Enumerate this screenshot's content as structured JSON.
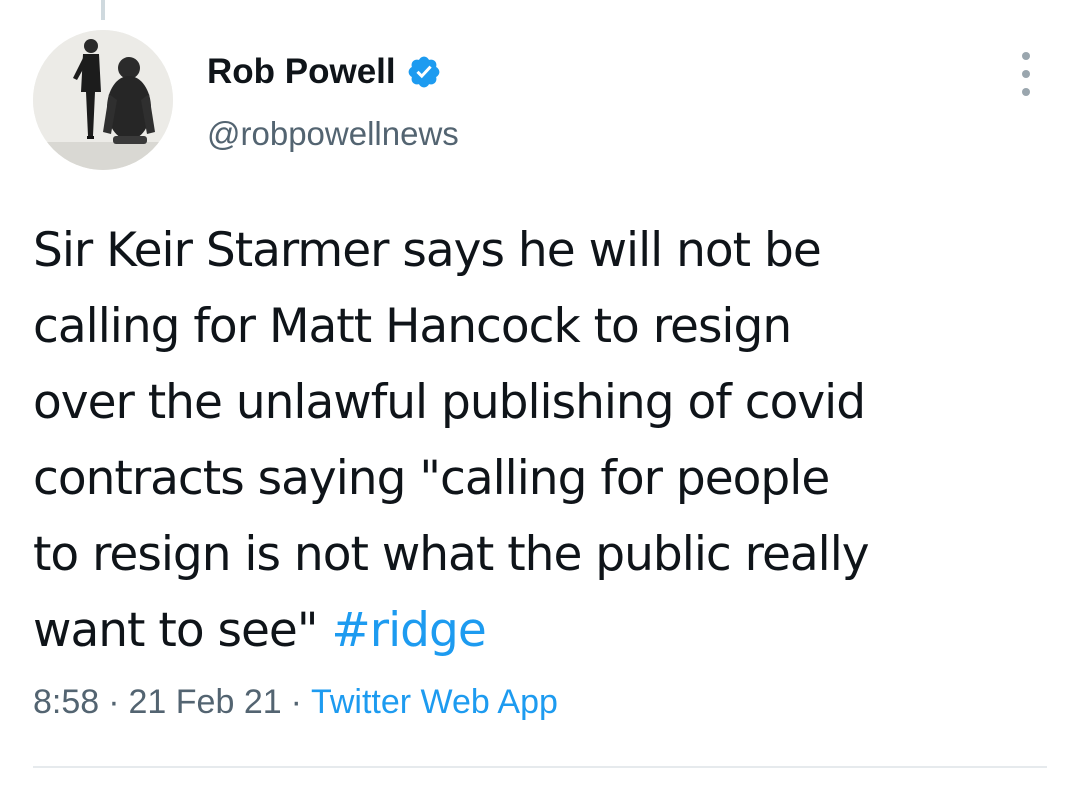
{
  "tweet": {
    "author": {
      "display_name": "Rob Powell",
      "handle": "@robpowellnews",
      "verified_icon": "verified-badge-icon",
      "avatar": "avatar-image"
    },
    "text_parts": {
      "line1": "Sir Keir Starmer says he will not be",
      "line2": "calling for Matt Hancock to resign",
      "line3": "over the unlawful publishing of covid",
      "line4": "contracts saying \"calling for people",
      "line5": "to resign is not what the public really",
      "line6_prefix": "want to see\" ",
      "hashtag": "#ridge"
    },
    "time": "8:58",
    "separator": "·",
    "date": "21 Feb 21",
    "source": "Twitter Web App",
    "more_icon": "more-options-icon"
  },
  "colors": {
    "link": "#1d9bf0",
    "secondary_text": "#536471",
    "primary_text": "#0f1419",
    "verified": "#1d9bf0"
  }
}
